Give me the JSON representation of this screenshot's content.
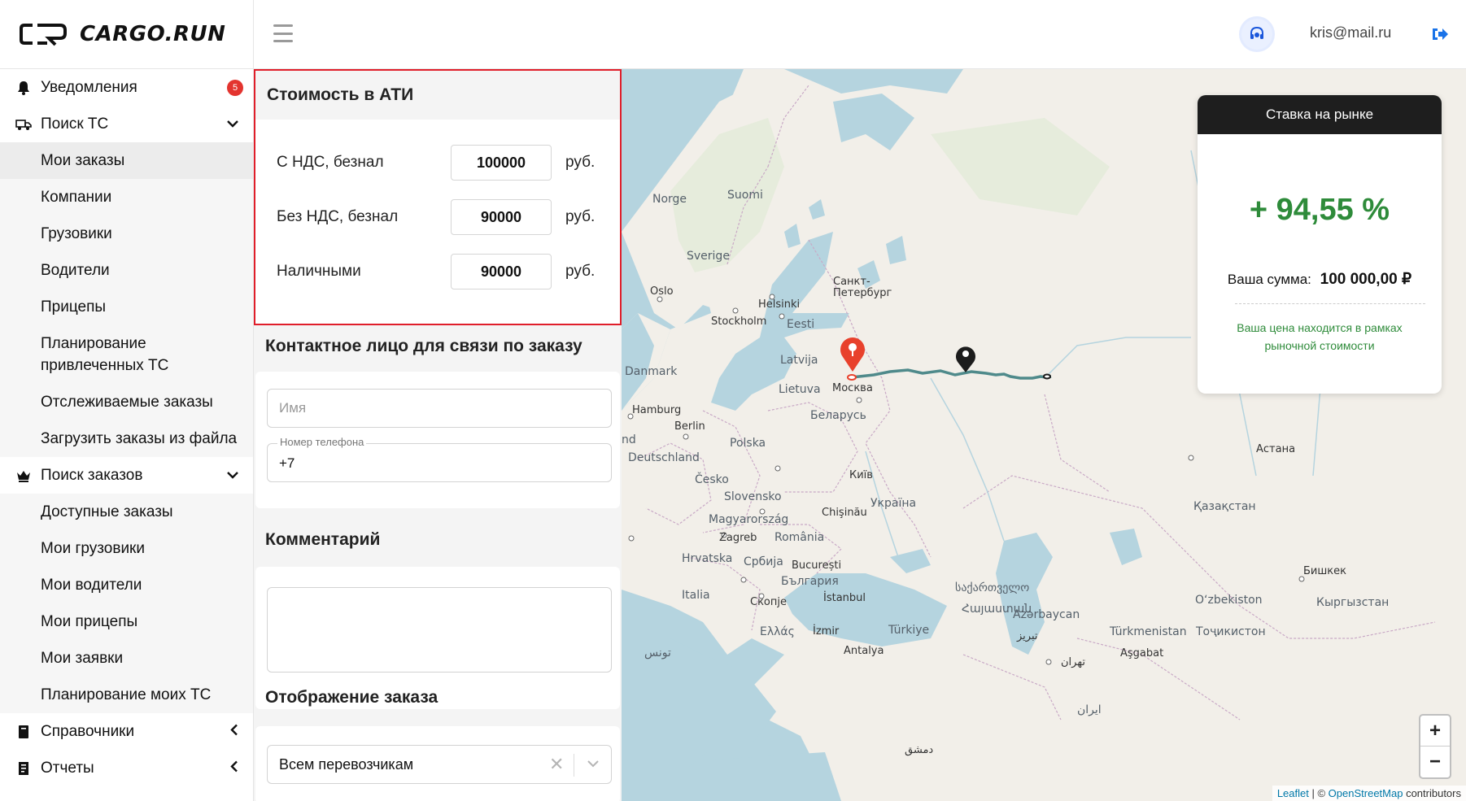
{
  "app": {
    "logo_text": "CARGO.RUN",
    "user_email": "kris@mail.ru"
  },
  "sidebar": {
    "items": [
      {
        "label": "Уведомления",
        "icon": "bell-icon",
        "badge": "5"
      },
      {
        "label": "Поиск ТС",
        "icon": "truck-icon",
        "caret": "⌄"
      },
      {
        "label": "Мои заказы"
      },
      {
        "label": "Компании"
      },
      {
        "label": "Грузовики"
      },
      {
        "label": "Водители"
      },
      {
        "label": "Прицепы"
      },
      {
        "label": "Планирование привлеченных ТС"
      },
      {
        "label": "Отслеживаемые заказы"
      },
      {
        "label": "Загрузить заказы из файла"
      },
      {
        "label": "Поиск заказов",
        "icon": "crown-icon",
        "caret": "⌄"
      },
      {
        "label": "Доступные заказы"
      },
      {
        "label": "Мои грузовики"
      },
      {
        "label": "Мои водители"
      },
      {
        "label": "Мои прицепы"
      },
      {
        "label": "Мои заявки"
      },
      {
        "label": "Планирование моих ТС"
      },
      {
        "label": "Справочники",
        "icon": "book-icon",
        "caret": "‹"
      },
      {
        "label": "Отчеты",
        "icon": "report-icon",
        "caret": "‹"
      }
    ]
  },
  "ati": {
    "title": "Стоимость в АТИ",
    "rows": [
      {
        "label": "С НДС, безнал",
        "value": "100000",
        "unit": "руб."
      },
      {
        "label": "Без НДС, безнал",
        "value": "90000",
        "unit": "руб."
      },
      {
        "label": "Наличными",
        "value": "90000",
        "unit": "руб."
      }
    ]
  },
  "contact": {
    "title": "Контактное лицо для связи по заказу",
    "name_placeholder": "Имя",
    "phone_label": "Номер телефона",
    "phone_value": "+7"
  },
  "comment": {
    "title": "Комментарий"
  },
  "display": {
    "title": "Отображение заказа",
    "selected": "Всем перевозчикам",
    "clear_symbol": "✕",
    "arrow_symbol": "⌄"
  },
  "market": {
    "title": "Ставка на рынке",
    "percent": "+ 94,55 %",
    "sum_label": "Ваша сумма:",
    "sum_value": "100 000,00 ₽",
    "note": "Ваша цена находится в рамках рыночной стоимости"
  },
  "map": {
    "labels": [
      "Norge",
      "Suomi",
      "Sverige",
      "Oslo",
      "Helsinki",
      "Санкт-Петербург",
      "Stockholm",
      "Eesti",
      "Latvija",
      "Danmark",
      "Lietuva",
      "Москва",
      "Hamburg",
      "Berlin",
      "Беларусь",
      "Polska",
      "Deutschland",
      "nd",
      "Česko",
      "Київ",
      "Slovensko",
      "Україна",
      "Magyarország",
      "Chişinău",
      "Zagreb",
      "România",
      "Hrvatska",
      "Србија",
      "București",
      "България",
      "Italia",
      "Скопје",
      "İstanbul",
      "Ελλάς",
      "İzmir",
      "Türkiye",
      "Antalya",
      "საქართველო",
      "Հայաստան",
      "Azərbaycan",
      "Астана",
      "Қазақстан",
      "Бишкек",
      "Oʻzbekiston",
      "Кыргызстан",
      "Türkmenistan",
      "Тоҷикистон",
      "Aşgabat",
      "تونس",
      "دمشق",
      "تهران",
      "تبریز",
      "ایران"
    ],
    "zoom_in": "+",
    "zoom_out": "−",
    "attrib_leaflet": "Leaflet",
    "attrib_sep": " | © ",
    "attrib_osm": "OpenStreetMap",
    "attrib_tail": " contributors",
    "marker_start_color": "#e8412c",
    "marker_end_color": "#1c1c1c",
    "route_color": "#4f8a8b"
  }
}
